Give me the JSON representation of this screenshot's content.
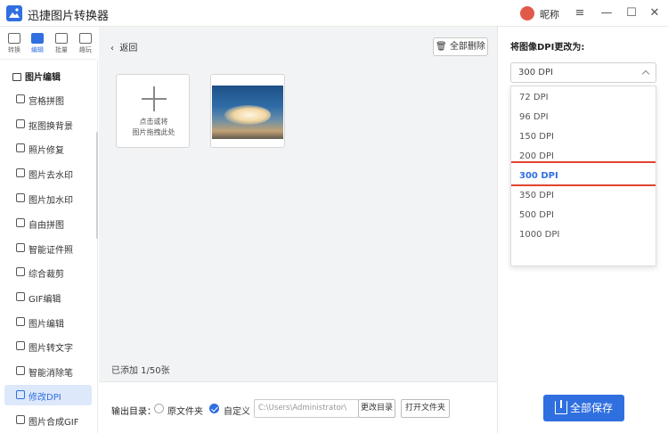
{
  "app": {
    "title": "迅捷图片转换器",
    "nickname": "昵称",
    "colors": {
      "accent": "#2f6fe0",
      "highlight": "#e0432f"
    }
  },
  "window": {
    "menu_icon": "≡",
    "minimize_icon": "—",
    "maximize_icon": "☐",
    "close_icon": "✕"
  },
  "rail": [
    {
      "label": "转换",
      "icon": "convert-icon"
    },
    {
      "label": "编辑",
      "icon": "edit-icon",
      "active": true
    },
    {
      "label": "批量",
      "icon": "batch-icon"
    },
    {
      "label": "趣玩",
      "icon": "fun-icon"
    }
  ],
  "sidebar": {
    "heading": "图片编辑",
    "items": [
      {
        "label": "宫格拼图"
      },
      {
        "label": "抠图换背景"
      },
      {
        "label": "照片修复"
      },
      {
        "label": "图片去水印"
      },
      {
        "label": "图片加水印"
      },
      {
        "label": "自由拼图"
      },
      {
        "label": "智能证件照"
      },
      {
        "label": "综合裁剪"
      },
      {
        "label": "GIF编辑"
      },
      {
        "label": "图片编辑"
      },
      {
        "label": "图片转文字"
      },
      {
        "label": "智能消除笔"
      },
      {
        "label": "修改DPI",
        "active": true
      },
      {
        "label": "图片合成GIF"
      }
    ]
  },
  "main": {
    "back_label": "返回",
    "delete_all_label": "全部删除",
    "add_card_line1": "点击或将",
    "add_card_line2": "图片拖拽此处",
    "count_text": "已添加 1/50张"
  },
  "output": {
    "label": "输出目录：",
    "option_original": "原文件夹",
    "option_custom": "自定义",
    "path_value": "C:\\Users\\Administrator\\",
    "change_dir_label": "更改目录",
    "open_folder_label": "打开文件夹"
  },
  "panel": {
    "title": "将图像DPI更改为:",
    "selected": "300 DPI",
    "options": [
      "72 DPI",
      "96 DPI",
      "150 DPI",
      "200 DPI",
      "300 DPI",
      "350 DPI",
      "500 DPI",
      "1000 DPI"
    ],
    "save_all_label": "全部保存"
  }
}
